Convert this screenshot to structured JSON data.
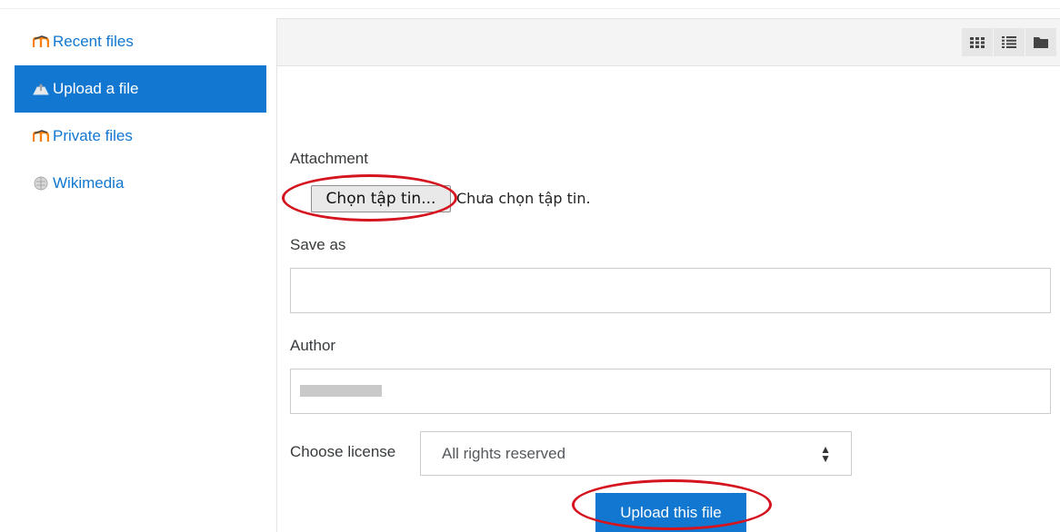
{
  "sidebar": {
    "items": [
      {
        "label": "Recent files",
        "icon": "moodle-icon",
        "active": false
      },
      {
        "label": "Upload a file",
        "icon": "upload-icon",
        "active": true
      },
      {
        "label": "Private files",
        "icon": "moodle-icon",
        "active": false
      },
      {
        "label": "Wikimedia",
        "icon": "wikimedia-icon",
        "active": false
      }
    ]
  },
  "toolbar": {
    "views": [
      "grid-view-icon",
      "list-view-icon",
      "folder-view-icon"
    ]
  },
  "form": {
    "attachment_label": "Attachment",
    "file_button_label": "Chọn tập tin...",
    "file_status": "Chưa chọn tập tin.",
    "save_as_label": "Save as",
    "save_as_value": "",
    "author_label": "Author",
    "license_label": "Choose license",
    "license_selected": "All rights reserved",
    "upload_button_label": "Upload this file"
  },
  "colors": {
    "accent": "#1177d1",
    "annotation": "#d4141e"
  }
}
